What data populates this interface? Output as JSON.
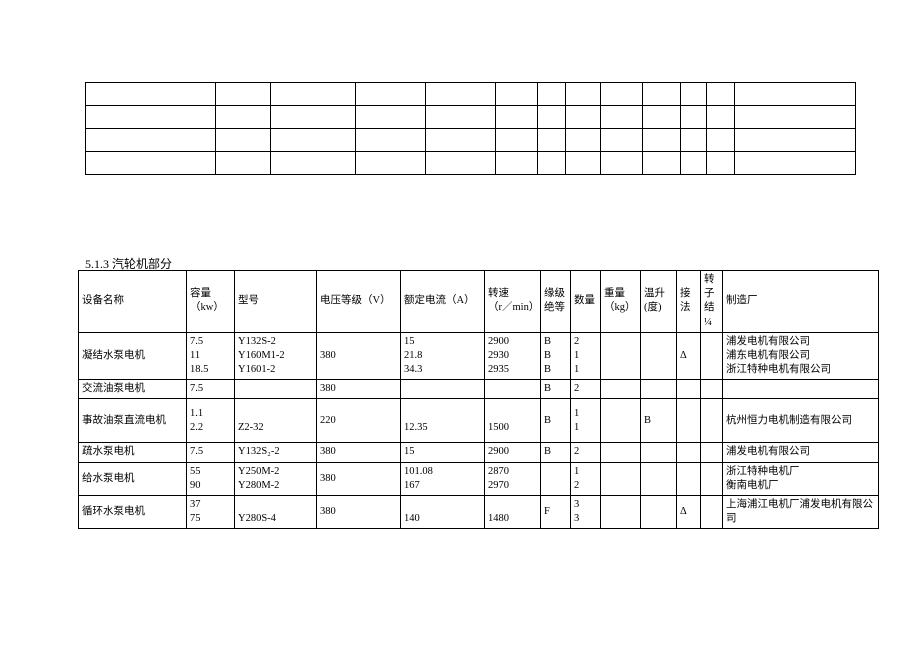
{
  "section_title": "5.1.3 汽轮机部分",
  "headers": {
    "name": "设备名称",
    "capacity": "容量\n（kw）",
    "model": "型号",
    "voltage": "电压等级（V）",
    "current": "额定电流（A）",
    "speed": "转速\n（r／min）",
    "insulation": "缘级绝等",
    "quantity": "数量",
    "weight": "重量\n（kg）",
    "temp": "温升\n(度)",
    "wiring": "接法",
    "rotor": "转子结¼",
    "mfr": "制造厂"
  },
  "rows": [
    {
      "name": "凝结水泵电机",
      "capacity": "7.5\n11\n18.5",
      "model": "Y132S-2\nY160M1-2\nY1601-2",
      "voltage": "380",
      "current": "15\n21.8\n34.3",
      "speed": "2900\n2930\n2935",
      "insulation": "B\nB\nB",
      "quantity": "2\n1\n1",
      "weight": "",
      "temp": "",
      "wiring": "Δ",
      "rotor": "",
      "mfr": "浦发电机有限公司\n浦东电机有限公司\n浙江特种电机有限公司"
    },
    {
      "name": "交流油泵电机",
      "capacity": "7.5",
      "model": "",
      "voltage": "380",
      "current": "",
      "speed": "",
      "insulation": "B",
      "quantity": "2",
      "weight": "",
      "temp": "",
      "wiring": "",
      "rotor": "",
      "mfr": ""
    },
    {
      "name": "事故油泵直流电机",
      "capacity": "1.1\n2.2",
      "model": "\nZ2-32",
      "voltage": "220",
      "current": "\n12.35",
      "speed": "\n1500",
      "insulation": "B",
      "quantity": "1\n1",
      "weight": "",
      "temp": "B",
      "wiring": "",
      "rotor": "",
      "mfr": "杭州恒力电机制造有限公司"
    },
    {
      "name": "疏水泵电机",
      "capacity": "7.5",
      "model": "Y132S₂-2",
      "voltage": "380",
      "current": "15",
      "speed": "2900",
      "insulation": "B",
      "quantity": "2",
      "weight": "",
      "temp": "",
      "wiring": "",
      "rotor": "",
      "mfr": "浦发电机有限公司"
    },
    {
      "name": "给水泵电机",
      "capacity": "55\n90",
      "model": "Y250M-2\nY280M-2",
      "voltage": "380",
      "current": "101.08\n167",
      "speed": "2870\n2970",
      "insulation": "",
      "quantity": "1\n2",
      "weight": "",
      "temp": "",
      "wiring": "",
      "rotor": "",
      "mfr": "浙江特种电机厂\n衡南电机厂"
    },
    {
      "name": "循环水泵电机",
      "capacity": "37\n75",
      "model": "\nY280S-4",
      "voltage": "380",
      "current": "\n140",
      "speed": "\n1480",
      "insulation": "F",
      "quantity": "3\n3",
      "weight": "",
      "temp": "",
      "wiring": "Δ",
      "rotor": "",
      "mfr": "上海浦江电机厂浦发电机有限公司"
    }
  ]
}
